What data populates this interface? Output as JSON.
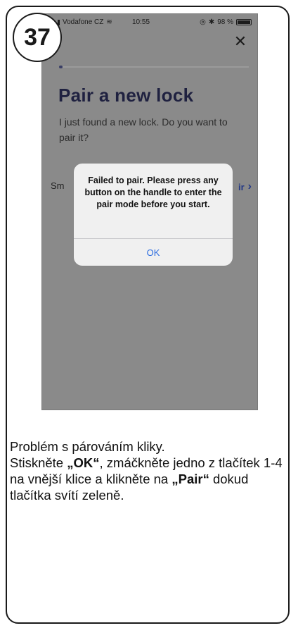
{
  "step": {
    "number": "37"
  },
  "status_bar": {
    "carrier": "Vodafone CZ",
    "time": "10:55",
    "battery": "98 %",
    "icons": [
      "signal-icon",
      "wifi-icon",
      "alarm-icon",
      "bluetooth-icon",
      "battery-icon"
    ]
  },
  "screen": {
    "close_icon": "close-icon",
    "progress": {
      "fraction": 0.02
    },
    "title": "Pair a new lock",
    "subtitle": "I just found a new lock. Do you want to pair it?",
    "row_left_label": "Sm",
    "row_right_label": "ir",
    "row_right_icon": "chevron-right-icon"
  },
  "alert": {
    "message": "Failed to pair. Please press any button on the handle to enter the pair mode before you start.",
    "ok_label": "OK"
  },
  "caption": {
    "line1": "Problém s párováním kliky.",
    "line2_prefix": "Stiskněte ",
    "line2_bold": "„OK“",
    "line2_suffix": ", zmáčkněte jedno z tlačítek 1-4 na vnější klice a klikněte na ",
    "line3_bold": "„Pair“",
    "line3_suffix": " dokud tlačítka svítí zeleně."
  },
  "colors": {
    "overlay_background": "#8a8a8a",
    "title": "#1f2140",
    "link": "#253a85",
    "alert_background": "#f0f0f0",
    "alert_button": "#2b6ce0"
  }
}
